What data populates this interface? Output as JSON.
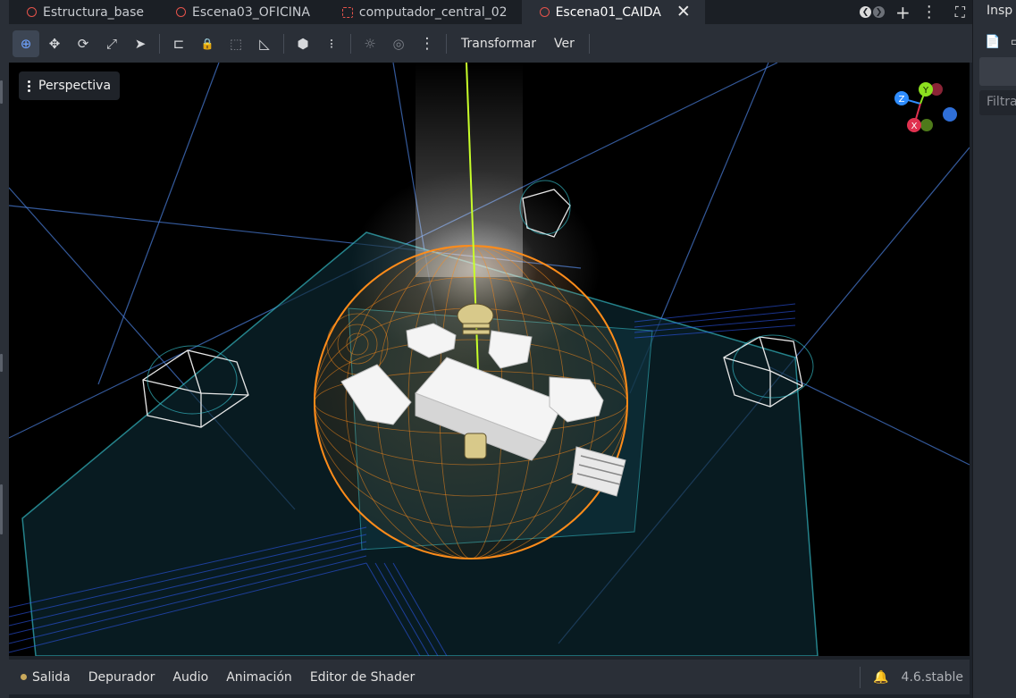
{
  "tabs": [
    {
      "label": "Estructura_base",
      "icon": "scene-ring-icon",
      "active": false
    },
    {
      "label": "Escena03_OFICINA",
      "icon": "scene-ring-icon",
      "active": false
    },
    {
      "label": "computador_central_02",
      "icon": "scene-dashed-icon",
      "active": false
    },
    {
      "label": "Escena01_CAIDA",
      "icon": "scene-ring-icon",
      "active": true
    }
  ],
  "tab_close_glyph": "✕",
  "tab_controls": {
    "prev": "❮",
    "next": "❯",
    "add": "+",
    "more": "⋮",
    "fullscreen": "⛶"
  },
  "toolbar": {
    "menus": {
      "transform": "Transformar",
      "view": "Ver"
    },
    "icons": {
      "select": "⊕",
      "move": "✥",
      "rotate": "⟳",
      "scale": "⤢",
      "list_select": "➤",
      "ruler": "⊏",
      "lock": "🔒",
      "group": "⬚",
      "snap": "◺",
      "camera": "⬢",
      "snap_grid": "⁝",
      "sun": "☼",
      "environment": "◎",
      "more": "⋮"
    }
  },
  "viewport": {
    "perspective_label": "Perspectiva"
  },
  "gizmo": {
    "x": "X",
    "y": "Y",
    "z": "Z"
  },
  "inspector": {
    "title": "Insp",
    "filter_placeholder": "Filtra",
    "icons": [
      "📄",
      "▭"
    ]
  },
  "bottom": {
    "items": [
      "Salida",
      "Depurador",
      "Audio",
      "Animación",
      "Editor de Shader"
    ],
    "version": "4.6.stable",
    "bell": "🔔"
  },
  "colors": {
    "accent": "#6fa3ff",
    "tab_icon": "#e5534b",
    "sphere": "#ff8c1a",
    "grid": "#3ad1dc",
    "gizmo_x": "#e0314f",
    "gizmo_y": "#8ce01f",
    "gizmo_z": "#2f8dff"
  }
}
